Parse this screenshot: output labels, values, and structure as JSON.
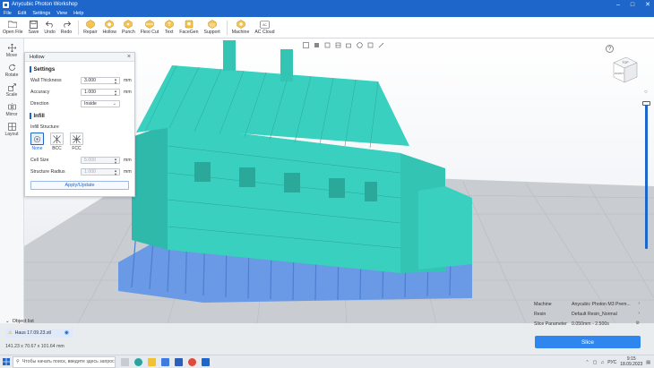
{
  "window": {
    "title": "Anycubic Photon Workshop"
  },
  "menu": [
    "File",
    "Edit",
    "Settings",
    "View",
    "Help"
  ],
  "toolbar": [
    {
      "label": "Open File",
      "icon": "folder-icon"
    },
    {
      "label": "Save",
      "icon": "save-icon"
    },
    {
      "label": "Undo",
      "icon": "undo-icon"
    },
    {
      "label": "Redo",
      "icon": "redo-icon"
    },
    {
      "label": "Repair",
      "icon": "repair-icon"
    },
    {
      "label": "Hollow",
      "icon": "hollow-icon"
    },
    {
      "label": "Punch",
      "icon": "punch-icon"
    },
    {
      "label": "Flexi Cut",
      "icon": "cut-icon"
    },
    {
      "label": "Text",
      "icon": "text-icon"
    },
    {
      "label": "FaceGen",
      "icon": "facegen-icon"
    },
    {
      "label": "Support",
      "icon": "support-icon"
    },
    {
      "label": "Machine",
      "icon": "machine-icon"
    },
    {
      "label": "AC Cloud",
      "icon": "cloud-icon"
    }
  ],
  "left_tools": [
    {
      "label": "Move",
      "icon": "move-icon"
    },
    {
      "label": "Rotate",
      "icon": "rotate-icon"
    },
    {
      "label": "Scale",
      "icon": "scale-icon"
    },
    {
      "label": "Mirror",
      "icon": "mirror-icon"
    },
    {
      "label": "Layout",
      "icon": "layout-icon"
    }
  ],
  "hollow_panel": {
    "title": "Hollow",
    "settings_title": "Settings",
    "wall_thickness_label": "Wall Thickness",
    "wall_thickness_value": "3.000",
    "accuracy_label": "Accuracy",
    "accuracy_value": "1.000",
    "direction_label": "Direction",
    "direction_value": "Inside",
    "unit": "mm",
    "infill_title": "Infill",
    "infill_structure_label": "Infill Structure",
    "structures": [
      "None",
      "BCC",
      "FCC"
    ],
    "cell_size_label": "Cell Size",
    "cell_size_value": "5.000",
    "structure_radius_label": "Structure Radius",
    "structure_radius_value": "1.000",
    "apply_label": "Apply/Update"
  },
  "nav_cube": {
    "top_label": "TOP",
    "front_label": "FRONT"
  },
  "object_list": {
    "title": "Object list",
    "item": "Haus 17.09.23.stl",
    "dims": "141.23 x 70.67 x 101.64 mm"
  },
  "slice_panel": {
    "machine_label": "Machine",
    "machine_value": "Anycubic Photon M3 Prem...",
    "resin_label": "Resin",
    "resin_value": "Default Resin_Normal",
    "param_label": "Slice Parameter",
    "param_value": "0.050mm - 2.500s",
    "slice_label": "Slice"
  },
  "taskbar": {
    "search_placeholder": "Чтобы начать поиск, введите здесь запрос",
    "lang": "РУС",
    "time": "9:15",
    "date": "18.09.2023"
  },
  "colors": {
    "accent": "#1e66c9",
    "model": "#3ad0c0",
    "supports": "#6a9ae6"
  }
}
